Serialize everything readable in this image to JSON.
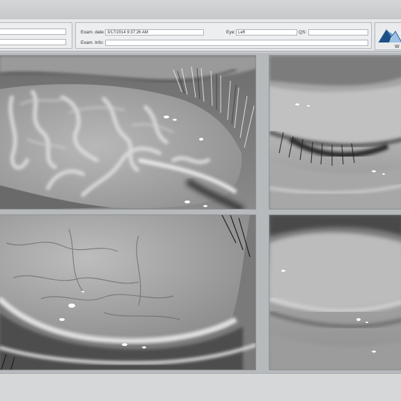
{
  "exam": {
    "date_label": "Exam. date:",
    "date_value": "3/17/2014 9:37:26 AM",
    "eye_label": "Eye:",
    "eye_value": "Left",
    "qs_label": "QS:",
    "qs_value": "",
    "info_label": "Exam. Info:",
    "info_value": ""
  },
  "logo": {
    "text": "W",
    "icon": "mountain-logo-icon"
  },
  "images": [
    {
      "name": "upper-everted-eyelid-image"
    },
    {
      "name": "upper-eyelid-margin-image"
    },
    {
      "name": "lower-eyelid-conjunctiva-image"
    },
    {
      "name": "lower-eyelid-margin-image"
    }
  ]
}
